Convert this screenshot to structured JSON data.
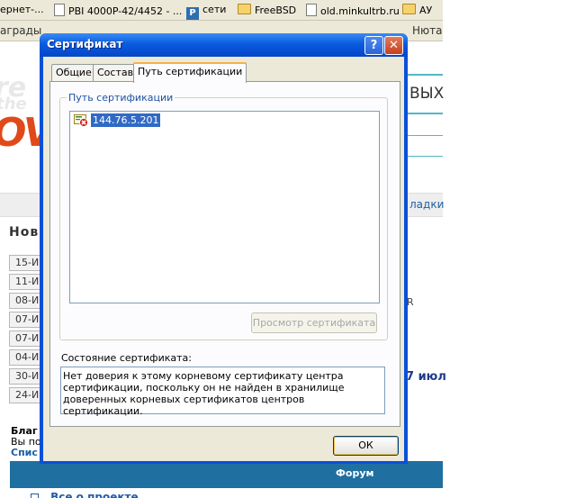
{
  "bookmarks_bar": {
    "items": [
      {
        "label": "ернет-..."
      },
      {
        "label": "PBI 4000P-42/4452 - ..."
      },
      {
        "label": "сети"
      },
      {
        "label": "FreeBSD"
      },
      {
        "label": "old.minkultrb.ru"
      },
      {
        "label": "АУ"
      }
    ]
  },
  "links_bar": {
    "items": [
      {
        "label": "аграды"
      },
      {
        "label": "Нюта"
      }
    ]
  },
  "background_page": {
    "heading_right": "вых",
    "link_right": "ладки",
    "news_heading": "Нов",
    "dates": [
      "15-И",
      "11-И",
      "08-И",
      "07-И",
      "07-И",
      "04-И",
      "30-И",
      "24-И"
    ],
    "text_r": "R",
    "text_july": "7 июл",
    "bottom_bold": "Благ",
    "bottom_line": "Вы по",
    "bottom_link": "Спис",
    "forum_header": "Форум",
    "footer_link": "Все о проекте"
  },
  "dialog": {
    "title": "Сертификат",
    "help_glyph": "?",
    "close_glyph": "✕",
    "tabs": [
      {
        "label": "Общие",
        "active": false
      },
      {
        "label": "Состав",
        "active": false
      },
      {
        "label": "Путь сертификации",
        "active": true
      }
    ],
    "group_title": "Путь сертификации",
    "tree": {
      "items": [
        {
          "label": "144.76.5.201",
          "icon": "certificate-error-icon",
          "selected": true
        }
      ]
    },
    "view_cert_button": "Просмотр сертификата",
    "status_label": "Состояние сертификата:",
    "status_text": "Нет доверия к этому корневому сертификату центра сертификации, поскольку он не найден в хранилище доверенных корневых сертификатов центров сертификации.",
    "ok_button": "ОК"
  },
  "colors": {
    "titlebar": "#0a5bdf",
    "dialog_bg": "#ece9d8",
    "selection": "#316ac5",
    "accent_tab": "#f6b24a",
    "forum_bar": "#1f6fa0"
  }
}
